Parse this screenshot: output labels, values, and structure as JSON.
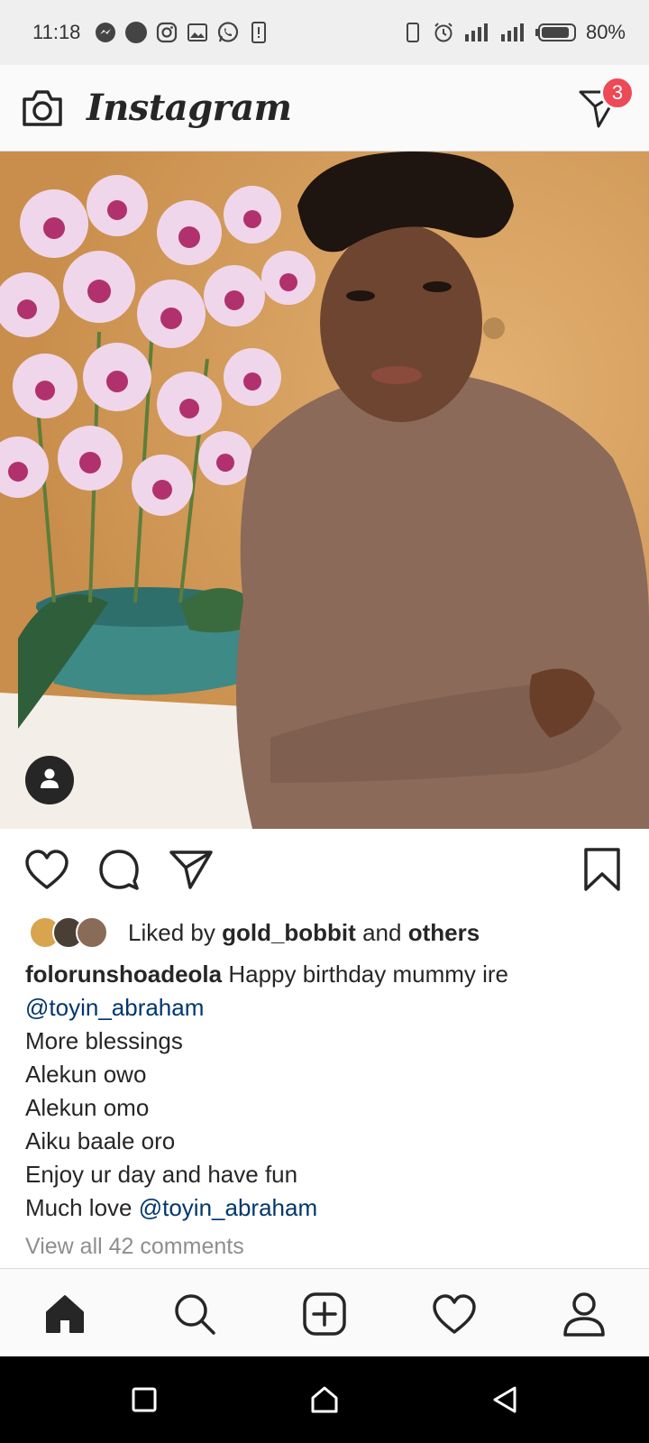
{
  "status_bar": {
    "time": "11:18",
    "battery": "80%",
    "left_icons": [
      "messenger-icon",
      "dot-icon",
      "instagram-icon",
      "gallery-icon",
      "whatsapp-icon",
      "sim-alert-icon"
    ],
    "right_icons": [
      "vibrate-icon",
      "alarm-icon",
      "signal-icon",
      "signal-icon",
      "battery-icon"
    ]
  },
  "header": {
    "brand": "Instagram",
    "camera_icon": "camera-icon",
    "direct_icon": "direct-message-icon",
    "direct_badge": "3"
  },
  "post": {
    "tag_icon": "user-tag-icon",
    "actions": {
      "like_icon": "heart-icon",
      "comment_icon": "comment-icon",
      "share_icon": "send-icon",
      "save_icon": "bookmark-icon"
    },
    "liked_by": {
      "prefix": "Liked by",
      "user": "gold_bobbit",
      "and": "and",
      "others": "others"
    },
    "caption": {
      "username": "folorunshoadeola",
      "first_line": "Happy birthday mummy ire",
      "mention_1": "@toyin_abraham",
      "lines": [
        "More blessings",
        "Alekun owo",
        "Alekun omo",
        "Aiku baale oro",
        "Enjoy ur day and have fun"
      ],
      "last_prefix": "Much love",
      "mention_2": "@toyin_abraham"
    },
    "view_comments": "View all 42 comments"
  },
  "bottom_nav": {
    "items": [
      "home-icon",
      "search-icon",
      "new-post-icon",
      "activity-icon",
      "profile-icon"
    ]
  },
  "system_nav": {
    "items": [
      "recents-icon",
      "home-icon",
      "back-icon"
    ]
  },
  "colors": {
    "link": "#00376b",
    "badge": "#ed4956",
    "muted": "#8e8e8e"
  }
}
